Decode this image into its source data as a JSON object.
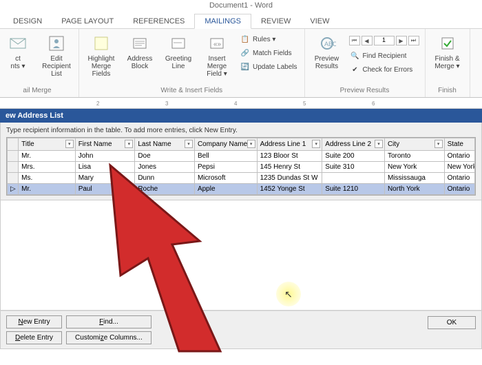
{
  "title": "Document1 - Word",
  "tabs": [
    "DESIGN",
    "PAGE LAYOUT",
    "REFERENCES",
    "MAILINGS",
    "REVIEW",
    "VIEW"
  ],
  "activeTab": "MAILINGS",
  "ribbon": {
    "g0_label": "ail Merge",
    "g0_btn1": "ct\nnts ▾",
    "g0_btn2": "Edit\nRecipient List",
    "g1_label": "Write & Insert Fields",
    "g1_btn1": "Highlight\nMerge Fields",
    "g1_btn2": "Address\nBlock",
    "g1_btn3": "Greeting\nLine",
    "g1_btn4": "Insert Merge\nField ▾",
    "g1_s1": "Rules ▾",
    "g1_s2": "Match Fields",
    "g1_s3": "Update Labels",
    "g2_label": "Preview Results",
    "g2_btn1": "Preview\nResults",
    "g2_nav_num": "1",
    "g2_s1": "Find Recipient",
    "g2_s2": "Check for Errors",
    "g3_label": "Finish",
    "g3_btn1": "Finish &\nMerge ▾"
  },
  "ruler": [
    "2",
    "3",
    "4",
    "5",
    "6"
  ],
  "dialog": {
    "title": "ew Address List",
    "instruction": "Type recipient information in the table.  To add more entries, click New Entry.",
    "columns": [
      "Title",
      "First Name",
      "Last Name",
      "Company Name",
      "Address Line 1",
      "Address Line 2",
      "City",
      "State"
    ],
    "rows": [
      {
        "sel": "",
        "cells": [
          "Mr.",
          "John",
          "Doe",
          "Bell",
          "123 Bloor St",
          "Suite 200",
          "Toronto",
          "Ontario"
        ]
      },
      {
        "sel": "",
        "cells": [
          "Mrs.",
          "Lisa",
          "Jones",
          "Pepsi",
          "145 Henry St",
          "Suite 310",
          "New York",
          "New York"
        ]
      },
      {
        "sel": "",
        "cells": [
          "Ms.",
          "Mary",
          "Dunn",
          "Microsoft",
          "1235 Dundas St W",
          "",
          "Mississauga",
          "Ontario"
        ]
      },
      {
        "sel": "▷",
        "selected": true,
        "cells": [
          "Mr.",
          "Paul",
          "Roche",
          "Apple",
          "1452 Yonge St",
          "Suite 1210",
          "North York",
          "Ontario"
        ]
      }
    ],
    "buttons": {
      "new_entry": "New Entry",
      "delete_entry": "Delete Entry",
      "find": "Find...",
      "customize": "Customize Columns...",
      "ok": "OK"
    }
  }
}
